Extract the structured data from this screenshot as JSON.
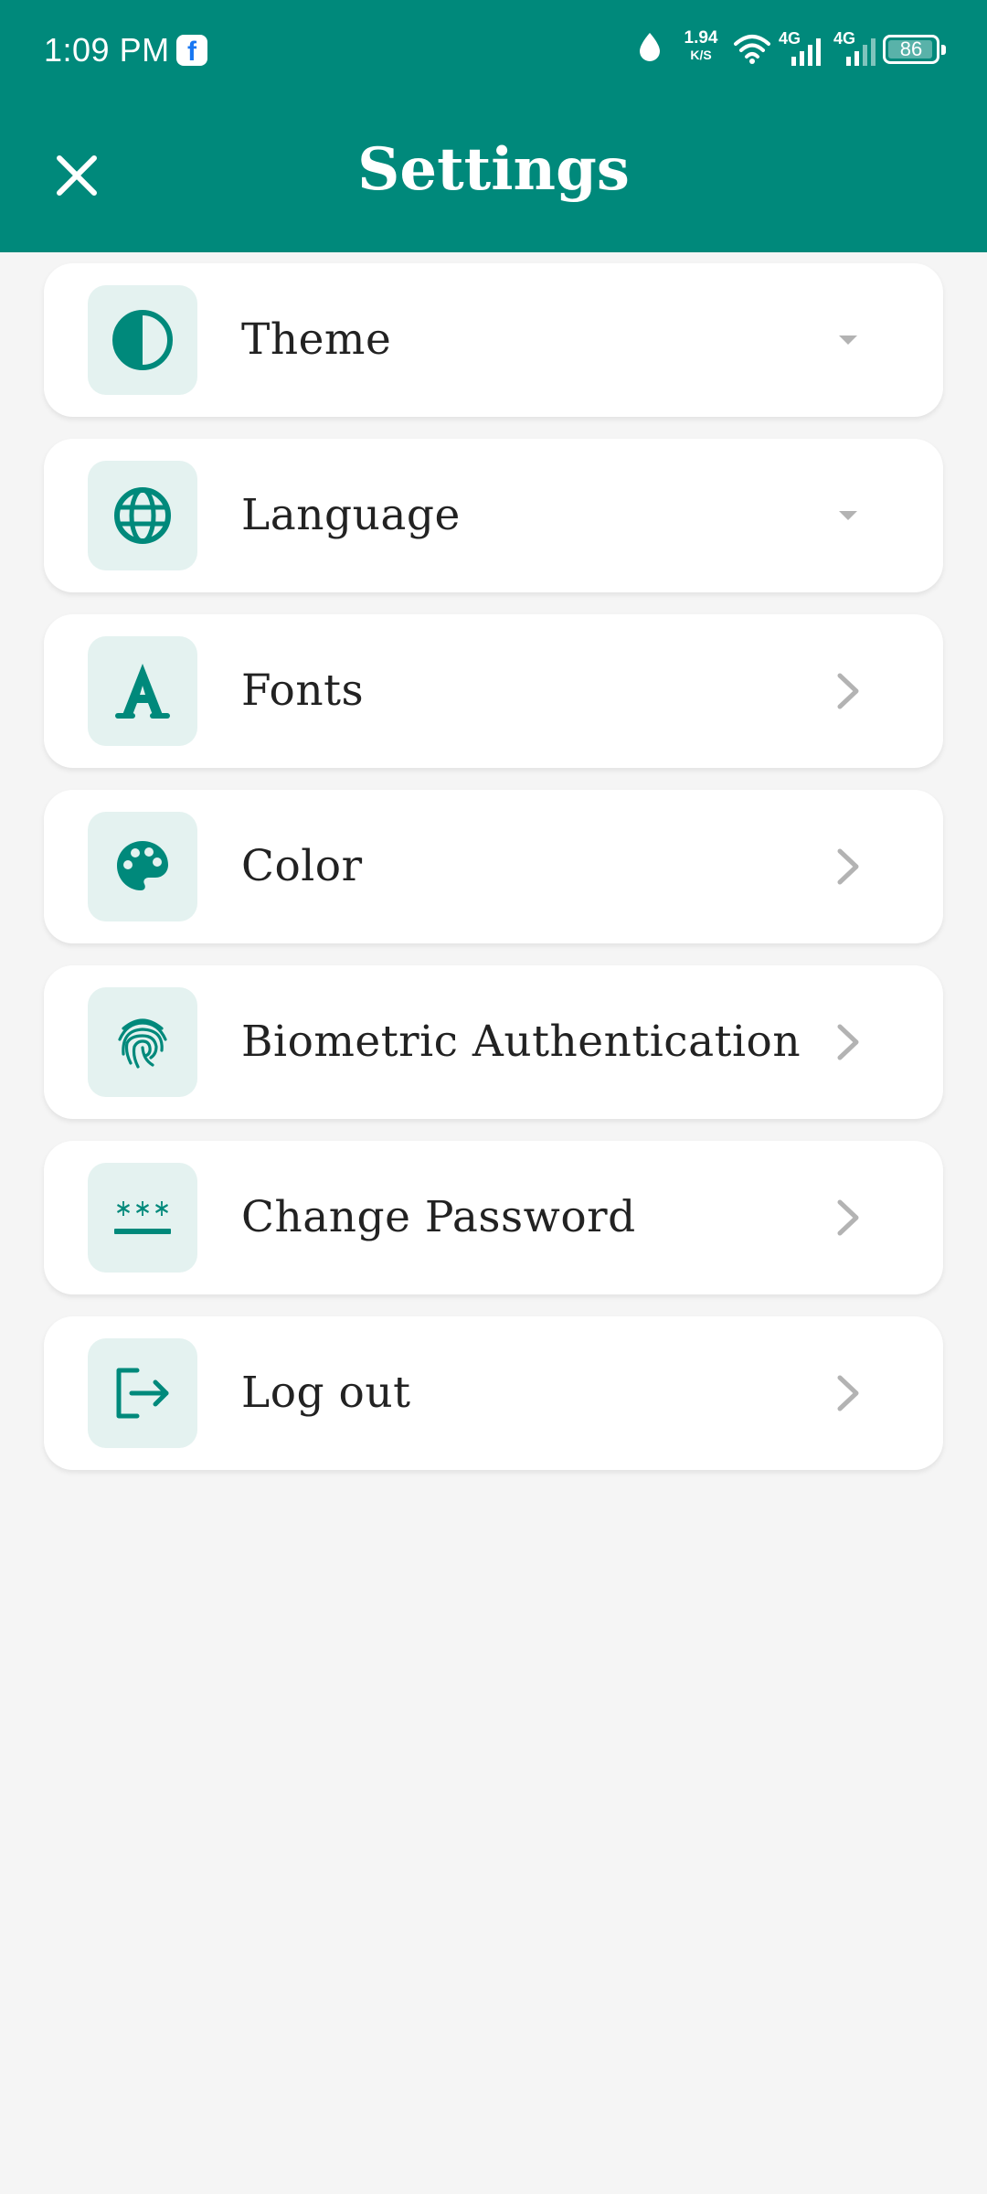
{
  "status_bar": {
    "time": "1:09 PM",
    "app_notification_icon": "facebook-icon",
    "net_speed_value": "1.94",
    "net_speed_unit": "K/S",
    "network_1": "4G",
    "network_2": "4G",
    "battery": "86"
  },
  "header": {
    "title": "Settings",
    "close_icon": "close-icon"
  },
  "colors": {
    "primary": "#00897b",
    "icon_bg": "#e4f2f0",
    "background": "#f5f5f5",
    "chevron": "#b3b3b3"
  },
  "settings": [
    {
      "label": "Theme",
      "icon": "contrast-icon",
      "trailing": "dropdown-arrow"
    },
    {
      "label": "Language",
      "icon": "globe-icon",
      "trailing": "dropdown-arrow"
    },
    {
      "label": "Fonts",
      "icon": "font-icon",
      "trailing": "chevron-right"
    },
    {
      "label": "Color",
      "icon": "palette-icon",
      "trailing": "chevron-right"
    },
    {
      "label": "Biometric Authentication",
      "icon": "fingerprint-icon",
      "trailing": "chevron-right"
    },
    {
      "label": "Change Password",
      "icon": "password-icon",
      "trailing": "chevron-right"
    },
    {
      "label": "Log out",
      "icon": "logout-icon",
      "trailing": "chevron-right"
    }
  ]
}
